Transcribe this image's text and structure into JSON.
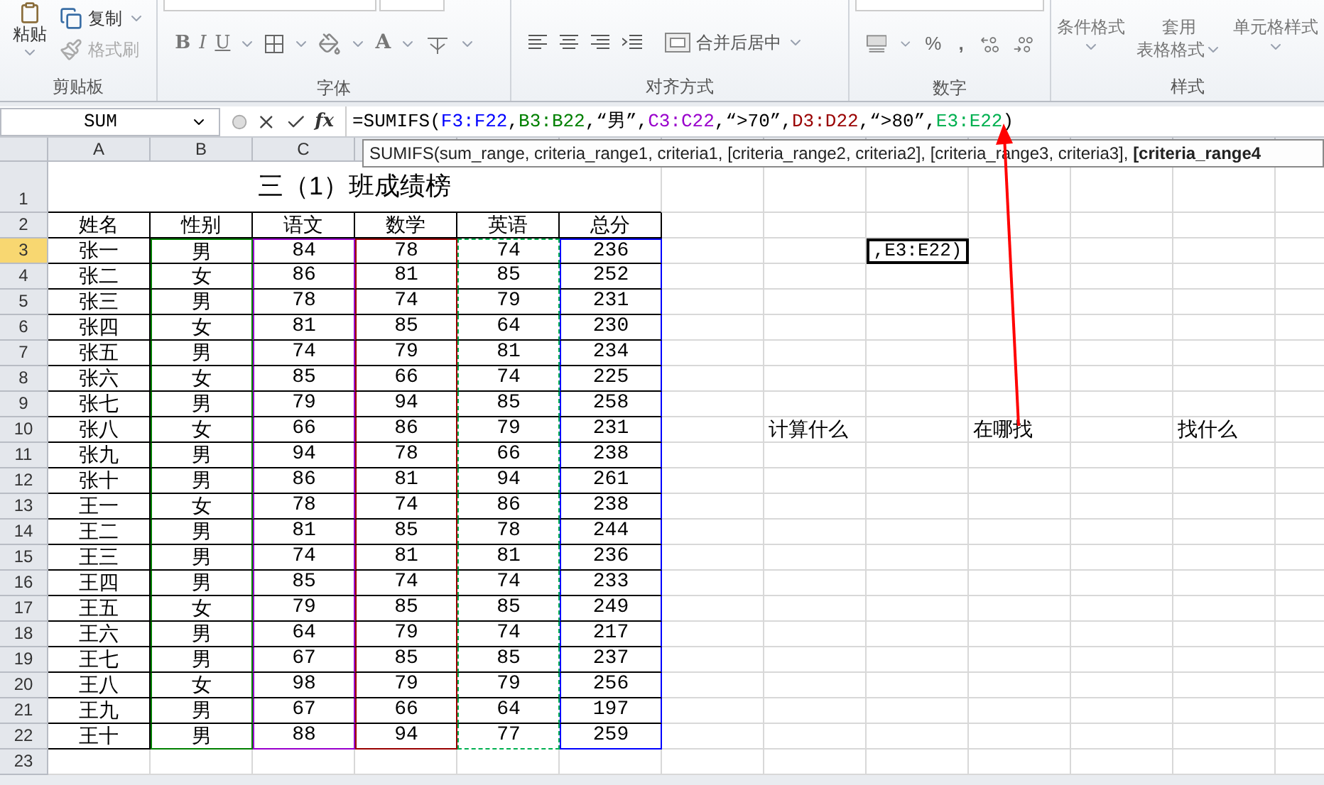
{
  "ribbon": {
    "clipboard": {
      "label": "剪贴板",
      "paste": "粘贴",
      "copy": "复制",
      "format_painter": "格式刷"
    },
    "font": {
      "label": "字体",
      "bold": "B",
      "italic": "I",
      "underline": "U",
      "font_color": "A"
    },
    "alignment": {
      "label": "对齐方式",
      "merge": "合并后居中"
    },
    "number": {
      "label": "数字",
      "percent": "%",
      "comma": ","
    },
    "styles": {
      "label": "样式",
      "conditional": "条件格式",
      "table_format": [
        "套用",
        "表格格式"
      ],
      "cell_styles": "单元格样式"
    }
  },
  "formula_bar": {
    "name_box": "SUM",
    "fx": "fx",
    "formula": [
      {
        "text": "=SUMIFS(",
        "color": "#000000"
      },
      {
        "text": "F3:F22",
        "color": "#0000ff"
      },
      {
        "text": ",",
        "color": "#000000"
      },
      {
        "text": "B3:B22",
        "color": "#008000"
      },
      {
        "text": ",“男”,",
        "color": "#000000"
      },
      {
        "text": "C3:C22",
        "color": "#9900cc"
      },
      {
        "text": ",“>70”,",
        "color": "#000000"
      },
      {
        "text": "D3:D22",
        "color": "#990000"
      },
      {
        "text": ",“>80”,",
        "color": "#000000"
      },
      {
        "text": "E3:E22",
        "color": "#00b050"
      },
      {
        "text": ")",
        "color": "#000000"
      }
    ]
  },
  "tooltip": "SUMIFS(sum_range, criteria_range1, criteria1, [criteria_range2, criteria2], [criteria_range3, criteria3], **[criteria_range4**",
  "column_headers": [
    "A",
    "B",
    "C"
  ],
  "row_headers": [
    {
      "label": "1",
      "selected": false
    },
    {
      "label": "2",
      "selected": false
    },
    {
      "label": "3",
      "selected": true
    },
    {
      "label": "4",
      "selected": false
    },
    {
      "label": "5",
      "selected": false
    },
    {
      "label": "6",
      "selected": false
    },
    {
      "label": "7",
      "selected": false
    },
    {
      "label": "8",
      "selected": false
    },
    {
      "label": "9",
      "selected": false
    },
    {
      "label": "10",
      "selected": false
    },
    {
      "label": "11",
      "selected": false
    },
    {
      "label": "12",
      "selected": false
    },
    {
      "label": "13",
      "selected": false
    },
    {
      "label": "14",
      "selected": false
    },
    {
      "label": "15",
      "selected": false
    },
    {
      "label": "16",
      "selected": false
    },
    {
      "label": "17",
      "selected": false
    },
    {
      "label": "18",
      "selected": false
    },
    {
      "label": "19",
      "selected": false
    },
    {
      "label": "20",
      "selected": false
    },
    {
      "label": "21",
      "selected": false
    },
    {
      "label": "22",
      "selected": false
    },
    {
      "label": "23",
      "selected": false
    }
  ],
  "sheet": {
    "title": "三（1）班成绩榜",
    "header": [
      "姓名",
      "性别",
      "语文",
      "数学",
      "英语",
      "总分"
    ],
    "range_highlights": [
      {
        "color": "#008000",
        "kind": "solid"
      },
      {
        "color": "#9900cc",
        "kind": "solid"
      },
      {
        "color": "#990000",
        "kind": "solid"
      },
      {
        "color": "#00b050",
        "kind": "dashed"
      },
      {
        "color": "#0000ff",
        "kind": "solid"
      }
    ],
    "rows": [
      [
        "张一",
        "男",
        "84",
        "78",
        "74",
        "236"
      ],
      [
        "张二",
        "女",
        "86",
        "81",
        "85",
        "252"
      ],
      [
        "张三",
        "男",
        "78",
        "74",
        "79",
        "231"
      ],
      [
        "张四",
        "女",
        "81",
        "85",
        "64",
        "230"
      ],
      [
        "张五",
        "男",
        "74",
        "79",
        "81",
        "234"
      ],
      [
        "张六",
        "女",
        "85",
        "66",
        "74",
        "225"
      ],
      [
        "张七",
        "男",
        "79",
        "94",
        "85",
        "258"
      ],
      [
        "张八",
        "女",
        "66",
        "86",
        "79",
        "231"
      ],
      [
        "张九",
        "男",
        "94",
        "78",
        "66",
        "238"
      ],
      [
        "张十",
        "男",
        "86",
        "81",
        "94",
        "261"
      ],
      [
        "王一",
        "女",
        "78",
        "74",
        "86",
        "238"
      ],
      [
        "王二",
        "男",
        "81",
        "85",
        "78",
        "244"
      ],
      [
        "王三",
        "男",
        "74",
        "81",
        "81",
        "236"
      ],
      [
        "王四",
        "男",
        "85",
        "74",
        "74",
        "233"
      ],
      [
        "王五",
        "女",
        "79",
        "85",
        "85",
        "249"
      ],
      [
        "王六",
        "男",
        "64",
        "79",
        "74",
        "217"
      ],
      [
        "王七",
        "男",
        "67",
        "85",
        "85",
        "237"
      ],
      [
        "王八",
        "女",
        "98",
        "79",
        "79",
        "256"
      ],
      [
        "王九",
        "男",
        "67",
        "66",
        "64",
        "197"
      ],
      [
        "王十",
        "男",
        "88",
        "94",
        "77",
        "259"
      ]
    ],
    "active_cell": ",E3:E22)",
    "notes": [
      "计算什么",
      "在哪找",
      "找什么"
    ]
  }
}
